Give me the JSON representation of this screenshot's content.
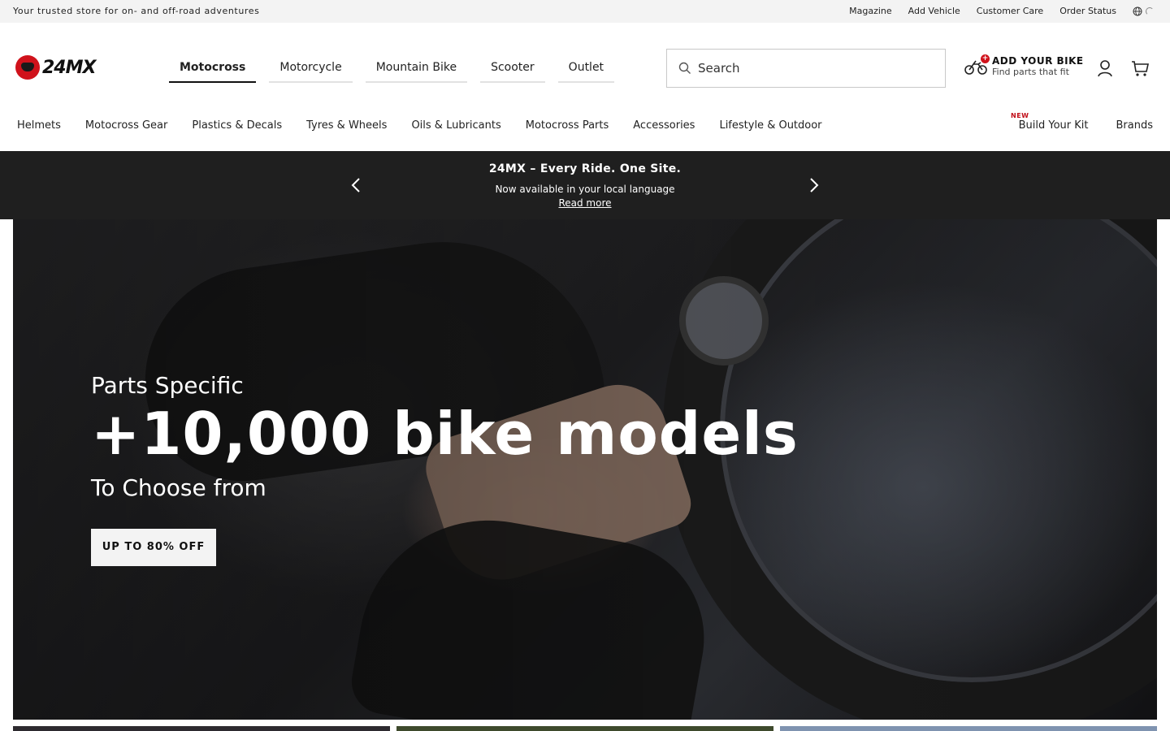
{
  "topbar": {
    "tagline": "Your trusted store for on- and off-road adventures",
    "links": [
      "Magazine",
      "Add Vehicle",
      "Customer Care",
      "Order Status"
    ]
  },
  "brand": {
    "logo_text": "24MX",
    "accent": "#d0121b"
  },
  "category_tabs": [
    {
      "label": "Motocross",
      "active": true
    },
    {
      "label": "Motorcycle",
      "active": false
    },
    {
      "label": "Mountain Bike",
      "active": false
    },
    {
      "label": "Scooter",
      "active": false
    },
    {
      "label": "Outlet",
      "active": false
    }
  ],
  "search": {
    "placeholder": "Search",
    "icon": "search-icon"
  },
  "add_bike": {
    "title": "ADD YOUR BIKE",
    "subtitle": "Find parts that fit",
    "icon": "motorcycle-icon"
  },
  "icons": {
    "account": "user-icon",
    "cart": "cart-icon",
    "language": "globe-icon"
  },
  "subnav": {
    "left": [
      "Helmets",
      "Motocross Gear",
      "Plastics & Decals",
      "Tyres & Wheels",
      "Oils & Lubricants",
      "Motocross Parts",
      "Accessories",
      "Lifestyle & Outdoor"
    ],
    "right": [
      "Build Your Kit",
      "Brands"
    ],
    "new_badge": "NEW"
  },
  "promo": {
    "title": "24MX – Every Ride. One Site.",
    "subtitle": "Now available in your local language",
    "link": "Read more"
  },
  "hero": {
    "eyebrow": "Parts Specific",
    "headline": "+10,000 bike models",
    "subline": "To Choose from",
    "cta": "UP TO 80% OFF"
  }
}
